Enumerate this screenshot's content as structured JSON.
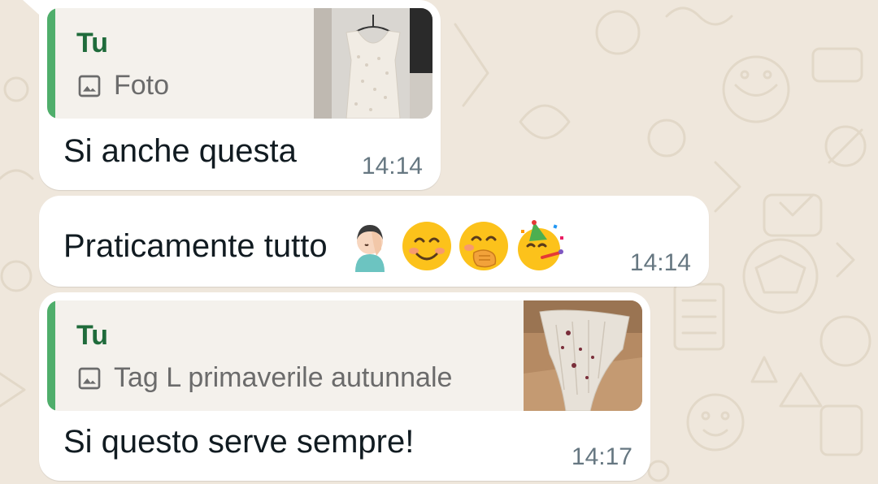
{
  "messages": [
    {
      "quote": {
        "author": "Tu",
        "sub_label": "Foto",
        "media_icon": "image-icon"
      },
      "text": "Si anche questa",
      "time": "14:14"
    },
    {
      "text": "Praticamente tutto",
      "emojis": [
        "woman-facepalming-emoji",
        "smiling-face-emoji",
        "hand-over-mouth-emoji",
        "partying-face-emoji"
      ],
      "time": "14:14"
    },
    {
      "quote": {
        "author": "Tu",
        "sub_label": "Tag L primaverile autunnale",
        "media_icon": "image-icon"
      },
      "text": "Si questo serve sempre!",
      "time": "14:17"
    }
  ],
  "colors": {
    "background": "#efe7dc",
    "bubble": "#ffffff",
    "quote_background": "#f4f1ec",
    "quote_bar": "#4fae6b",
    "quote_author": "#1f6b3b",
    "timestamp": "#667781"
  }
}
